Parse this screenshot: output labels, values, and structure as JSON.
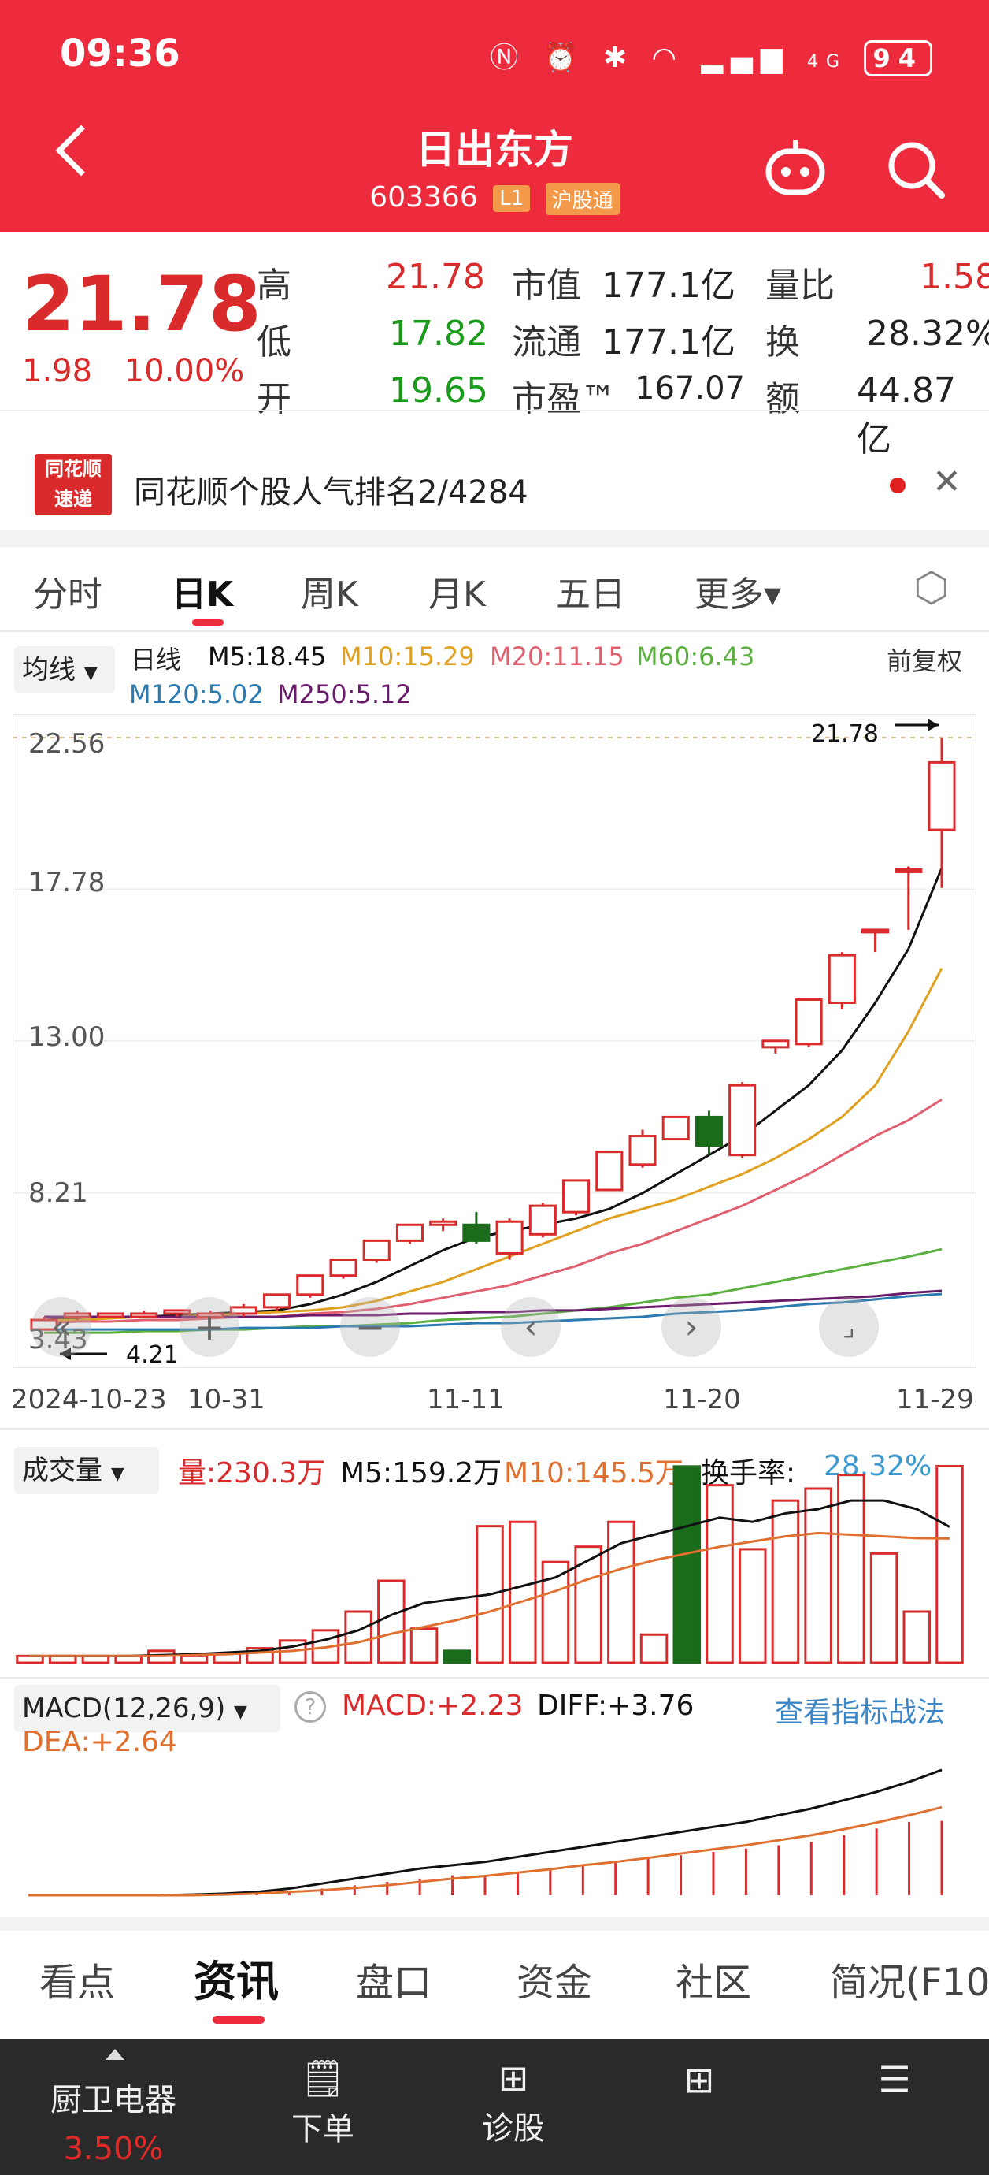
{
  "status": {
    "time": "09:36",
    "battery": "94",
    "signal_label": "4G"
  },
  "header": {
    "title": "日出东方",
    "code": "603366",
    "tag_l1": "L1",
    "tag_connect": "沪股通"
  },
  "quote": {
    "price": "21.78",
    "change": "1.98",
    "change_pct": "10.00%",
    "high_label": "高",
    "high": "21.78",
    "low_label": "低",
    "low": "17.82",
    "open_label": "开",
    "open": "19.65",
    "mcap_label": "市值",
    "mcap": "177.1亿",
    "float_label": "流通",
    "float": "177.1亿",
    "pe_label": "市盈™",
    "pe": "167.07",
    "vr_label": "量比",
    "vr": "1.58",
    "turnover_label": "换",
    "turnover": "28.32%",
    "amount_label": "额",
    "amount": "44.87亿"
  },
  "news": {
    "logo_top": "同花顺",
    "logo_bottom": "速递",
    "text": "同花顺个股人气排名2/4284"
  },
  "period_tabs": [
    "分时",
    "日K",
    "周K",
    "月K",
    "五日",
    "更多▾"
  ],
  "ma_legend": {
    "select": "均线",
    "kind": "日线",
    "m5": "M5:18.45",
    "m10": "M10:15.29",
    "m20": "M20:11.15",
    "m60": "M60:6.43",
    "m120": "M120:5.02",
    "m250": "M250:5.12",
    "adjust": "前复权"
  },
  "price_axis": [
    "22.56",
    "17.78",
    "13.00",
    "8.21",
    "3.43"
  ],
  "annot": {
    "high": "21.78",
    "low": "4.21"
  },
  "dates": [
    "2024-10-23",
    "10-31",
    "11-11",
    "11-20",
    "11-29"
  ],
  "volume": {
    "select": "成交量",
    "vol": "量:230.3万",
    "m5": "M5:159.2万",
    "m10": "M10:145.5万",
    "turnover_label": "换手率:",
    "turnover": "28.32%"
  },
  "macd": {
    "select": "MACD(12,26,9)",
    "macd": "MACD:+2.23",
    "diff": "DIFF:+3.76",
    "dea": "DEA:+2.64",
    "link": "查看指标战法"
  },
  "bottom_tabs": [
    "看点",
    "资讯",
    "盘口",
    "资金",
    "社区",
    "简况(F10"
  ],
  "bottom_nav": {
    "stock": "厨卫电器",
    "stock_pct": "3.50%",
    "order": "下单",
    "diagnose": "诊股"
  },
  "colors": {
    "brand": "#ee2b3c",
    "up": "#d92b2b",
    "down": "#1a6b1a",
    "m5": "#111111",
    "m10": "#e0a020",
    "m20": "#e06070",
    "m60": "#5cb040",
    "m120": "#2a7ab0",
    "m250": "#6a1a6a"
  },
  "chart_data": {
    "type": "candlestick",
    "x": [
      "10-23",
      "10-24",
      "10-25",
      "10-28",
      "10-29",
      "10-30",
      "10-31",
      "11-01",
      "11-04",
      "11-05",
      "11-06",
      "11-07",
      "11-08",
      "11-11",
      "11-12",
      "11-13",
      "11-14",
      "11-15",
      "11-18",
      "11-19",
      "11-20",
      "11-21",
      "11-22",
      "11-25",
      "11-26",
      "11-27",
      "11-28",
      "11-29"
    ],
    "open": [
      3.9,
      4.3,
      4.3,
      4.3,
      4.4,
      4.3,
      4.4,
      4.6,
      5.0,
      5.6,
      6.1,
      6.7,
      7.2,
      7.2,
      6.3,
      6.9,
      7.6,
      8.3,
      9.1,
      9.9,
      10.6,
      9.4,
      12.8,
      12.9,
      14.2,
      16.5,
      18.4,
      19.65
    ],
    "close": [
      4.2,
      4.4,
      4.4,
      4.4,
      4.5,
      4.4,
      4.6,
      5.0,
      5.6,
      6.1,
      6.7,
      7.2,
      7.3,
      6.7,
      7.3,
      7.8,
      8.6,
      9.5,
      10.0,
      10.6,
      9.7,
      11.6,
      13.0,
      14.3,
      15.7,
      16.5,
      18.4,
      21.78
    ],
    "high": [
      4.3,
      4.5,
      4.4,
      4.5,
      4.5,
      4.5,
      4.7,
      5.0,
      5.6,
      6.1,
      6.7,
      7.2,
      7.4,
      7.6,
      7.4,
      7.9,
      8.6,
      9.5,
      10.2,
      10.6,
      10.8,
      11.7,
      13.0,
      14.3,
      15.8,
      16.5,
      18.5,
      22.56
    ],
    "low": [
      3.9,
      4.2,
      4.3,
      4.3,
      4.3,
      4.3,
      4.3,
      4.5,
      4.9,
      5.5,
      6.0,
      6.6,
      7.0,
      6.6,
      6.1,
      6.8,
      7.5,
      8.3,
      9.0,
      9.9,
      9.4,
      9.3,
      12.6,
      12.8,
      14.0,
      15.8,
      16.5,
      17.82
    ],
    "ma5": [
      4.2,
      4.25,
      4.3,
      4.3,
      4.35,
      4.4,
      4.45,
      4.5,
      4.7,
      5.0,
      5.4,
      5.9,
      6.4,
      6.8,
      7.0,
      7.2,
      7.4,
      7.7,
      8.2,
      8.8,
      9.4,
      10.0,
      10.8,
      11.6,
      12.7,
      14.2,
      15.9,
      18.45
    ],
    "ma10": [
      4.2,
      4.2,
      4.25,
      4.3,
      4.3,
      4.35,
      4.4,
      4.45,
      4.5,
      4.6,
      4.8,
      5.1,
      5.4,
      5.8,
      6.2,
      6.6,
      7.0,
      7.4,
      7.7,
      8.0,
      8.4,
      8.8,
      9.3,
      9.9,
      10.6,
      11.6,
      13.3,
      15.29
    ],
    "ma20": [
      4.1,
      4.15,
      4.15,
      4.2,
      4.2,
      4.25,
      4.3,
      4.3,
      4.4,
      4.45,
      4.55,
      4.7,
      4.9,
      5.1,
      5.3,
      5.6,
      5.9,
      6.3,
      6.6,
      7.0,
      7.4,
      7.8,
      8.3,
      8.8,
      9.4,
      10.0,
      10.5,
      11.15
    ],
    "ma60": [
      3.8,
      3.8,
      3.8,
      3.85,
      3.85,
      3.9,
      3.9,
      3.95,
      4.0,
      4.0,
      4.05,
      4.1,
      4.2,
      4.25,
      4.3,
      4.4,
      4.5,
      4.6,
      4.75,
      4.9,
      5.0,
      5.2,
      5.4,
      5.6,
      5.8,
      6.0,
      6.2,
      6.43
    ],
    "ma120": [
      3.9,
      3.9,
      3.9,
      3.9,
      3.9,
      3.9,
      3.95,
      3.95,
      3.95,
      4.0,
      4.0,
      4.0,
      4.05,
      4.1,
      4.1,
      4.15,
      4.2,
      4.25,
      4.3,
      4.4,
      4.45,
      4.5,
      4.6,
      4.7,
      4.75,
      4.85,
      4.95,
      5.02
    ],
    "ma250": [
      4.3,
      4.3,
      4.3,
      4.3,
      4.3,
      4.3,
      4.3,
      4.3,
      4.35,
      4.35,
      4.35,
      4.4,
      4.4,
      4.45,
      4.45,
      4.5,
      4.5,
      4.55,
      4.6,
      4.65,
      4.7,
      4.75,
      4.8,
      4.85,
      4.9,
      4.95,
      5.05,
      5.12
    ],
    "ylim": [
      3.43,
      22.56
    ],
    "volume": [
      8,
      8,
      8,
      8,
      14,
      8,
      11,
      17,
      26,
      38,
      60,
      96,
      40,
      14,
      160,
      165,
      118,
      136,
      165,
      33,
      230,
      208,
      133,
      190,
      204,
      220,
      128,
      60,
      230.3
    ],
    "vol_ma5": [
      8,
      8,
      8,
      8,
      9,
      10,
      12,
      14,
      19,
      27,
      38,
      56,
      70,
      75,
      80,
      90,
      100,
      120,
      140,
      150,
      160,
      170,
      165,
      175,
      180,
      190,
      190,
      180,
      159.2
    ],
    "vol_ma10": [
      8,
      8,
      8,
      8,
      8,
      9,
      10,
      12,
      14,
      18,
      24,
      34,
      42,
      50,
      60,
      72,
      84,
      98,
      110,
      120,
      128,
      136,
      142,
      148,
      152,
      150,
      148,
      146,
      145.5
    ],
    "macd_hist": [
      0,
      0,
      0,
      0,
      0,
      0,
      0,
      0.05,
      0.1,
      0.2,
      0.3,
      0.4,
      0.5,
      0.6,
      0.6,
      0.7,
      0.8,
      0.9,
      1.0,
      1.1,
      1.2,
      1.3,
      1.4,
      1.5,
      1.6,
      1.8,
      2.0,
      2.2,
      2.23
    ],
    "diff": [
      0,
      0,
      0,
      0,
      0,
      0.02,
      0.05,
      0.1,
      0.2,
      0.35,
      0.5,
      0.65,
      0.8,
      0.9,
      1.0,
      1.15,
      1.3,
      1.45,
      1.6,
      1.75,
      1.9,
      2.05,
      2.2,
      2.4,
      2.6,
      2.85,
      3.1,
      3.4,
      3.76
    ],
    "dea": [
      0,
      0,
      0,
      0,
      0,
      0,
      0.02,
      0.05,
      0.1,
      0.15,
      0.22,
      0.3,
      0.4,
      0.5,
      0.58,
      0.68,
      0.78,
      0.9,
      1.0,
      1.12,
      1.25,
      1.38,
      1.5,
      1.65,
      1.8,
      1.98,
      2.18,
      2.4,
      2.64
    ]
  }
}
